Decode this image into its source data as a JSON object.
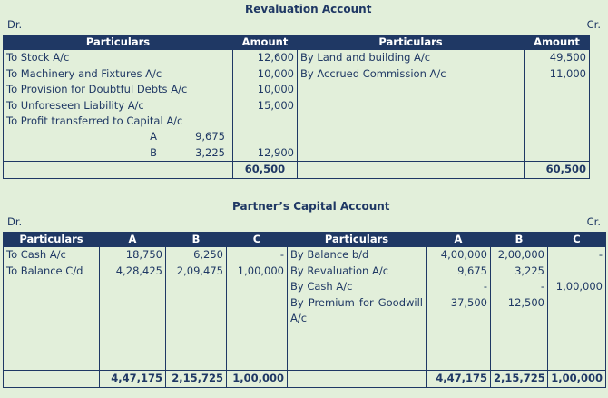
{
  "revaluation": {
    "title": "Revaluation Account",
    "dr": "Dr.",
    "cr": "Cr.",
    "headers": {
      "particulars": "Particulars",
      "amount": "Amount"
    },
    "debit": [
      {
        "text": "To Stock A/c",
        "amount": "12,600"
      },
      {
        "text": "To Machinery and Fixtures A/c",
        "amount": "10,000"
      },
      {
        "text": "To Provision for Doubtful Debts A/c",
        "amount": "10,000"
      },
      {
        "text": "To Unforeseen Liability A/c",
        "amount": "15,000"
      },
      {
        "text": "To Profit transferred to Capital A/c",
        "amount": ""
      }
    ],
    "profit_split": [
      {
        "partner": "A",
        "value": "9,675"
      },
      {
        "partner": "B",
        "value": "3,225"
      }
    ],
    "profit_total": "12,900",
    "credit": [
      {
        "text": "By Land and building A/c",
        "amount": "49,500"
      },
      {
        "text": "By Accrued Commission A/c",
        "amount": "11,000"
      }
    ],
    "total_dr": "60,500",
    "total_cr": "60,500"
  },
  "capital": {
    "title": "Partner’s Capital Account",
    "dr": "Dr.",
    "cr": "Cr.",
    "headers": {
      "particulars": "Particulars",
      "a": "A",
      "b": "B",
      "c": "C"
    },
    "debit": [
      {
        "text": "To Cash A/c",
        "a": "18,750",
        "b": "6,250",
        "c": "-"
      },
      {
        "text": "To Balance C/d",
        "a": "4,28,425",
        "b": "2,09,475",
        "c": "1,00,000"
      }
    ],
    "credit": [
      {
        "text": "By Balance b/d",
        "a": "4,00,000",
        "b": "2,00,000",
        "c": "-"
      },
      {
        "text": "By Revaluation A/c",
        "a": "9,675",
        "b": "3,225",
        "c": ""
      },
      {
        "text": "By Cash A/c",
        "a": "-",
        "b": "-",
        "c": "1,00,000"
      },
      {
        "text": "By Premium for Goodwill A/c",
        "a": "37,500",
        "b": "12,500",
        "c": ""
      }
    ],
    "totals_dr": {
      "a": "4,47,175",
      "b": "2,15,725",
      "c": "1,00,000"
    },
    "totals_cr": {
      "a": "4,47,175",
      "b": "2,15,725",
      "c": "1,00,000"
    }
  }
}
